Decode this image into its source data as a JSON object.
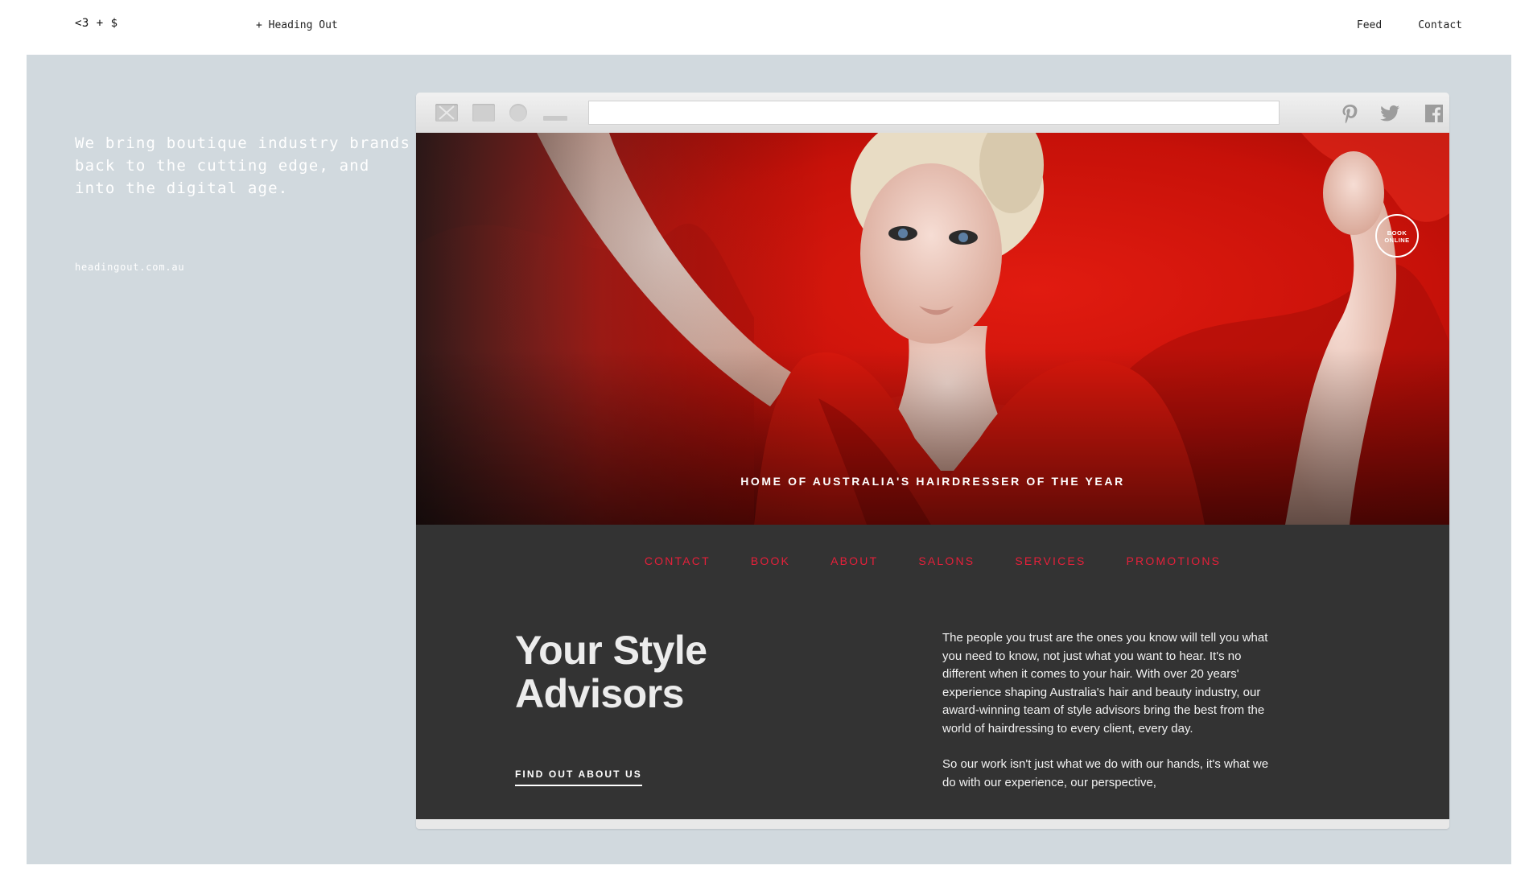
{
  "header": {
    "logo": "<3 + $",
    "breadcrumb": "+ Heading Out",
    "nav": [
      "Feed",
      "Contact"
    ]
  },
  "intro": {
    "tagline": "We bring boutique industry brands back to the cutting edge, and into the digital age.",
    "site_url": "headingout.com.au"
  },
  "browser": {
    "controls": [
      "close-icon",
      "maximize-icon",
      "record-icon",
      "minimize-icon"
    ],
    "url": "",
    "social": [
      "pinterest-icon",
      "twitter-icon",
      "facebook-icon"
    ]
  },
  "hero": {
    "caption": "HOME OF AUSTRALIA'S HAIRDRESSER OF THE YEAR",
    "badge_line1": "BOOK",
    "badge_line2": "ONLINE"
  },
  "site_nav": [
    "CONTACT",
    "BOOK",
    "ABOUT",
    "SALONS",
    "SERVICES",
    "PROMOTIONS"
  ],
  "section": {
    "headline_line1": "Your Style",
    "headline_line2": "Advisors",
    "cta": "FIND OUT ABOUT US",
    "paragraph1": "The people you trust are the ones you know will tell you what you need to know, not just what you want to hear. It's no different when it comes to your hair. With over 20 years' experience shaping Australia's hair and beauty industry, our award-winning team of style advisors bring the best from the world of hairdressing to every client, every day.",
    "paragraph2": "So our work isn't just what we do with our hands, it's what we do with our experience, our perspective,"
  },
  "colors": {
    "stage": "#d1d9de",
    "hero_red": "#d4140a",
    "nav_red": "#e5203a",
    "dark_panel": "#333333"
  }
}
